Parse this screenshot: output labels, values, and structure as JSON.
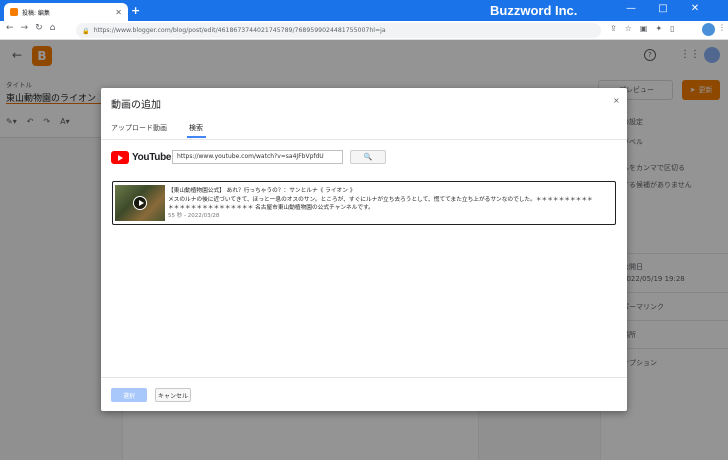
{
  "browser": {
    "tab_title": "投稿: 編集",
    "new_tab": "+",
    "address": "https://www.blogger.com/blog/post/edit/4618673744021745789/7689599024481755007hl=ja",
    "brand": "Buzzword Inc.",
    "window_controls": [
      "—",
      "□",
      "✕"
    ]
  },
  "header": {
    "title_label": "タイトル",
    "title_value": "東山動物園のライオン",
    "preview_label": "プレビュー",
    "update_label": "更新",
    "help_glyph": "?"
  },
  "sidebar": {
    "items": [
      "の設定",
      "ラベル",
      "ルをカンマで区切る",
      "する候補がありません",
      "公開日",
      "2022/05/19 19:28",
      "パーマリンク",
      "場所",
      "オプション"
    ]
  },
  "dialog": {
    "title": "動画の追加",
    "close": "×",
    "tabs": [
      "アップロード動画",
      "検索"
    ],
    "youtube_word": "YouTube",
    "search_value": "https://www.youtube.com/watch?v=sa4JFbVpfdU",
    "search_button": "🔍",
    "result": {
      "title": "【東山動植物園公式】 あれ？行っちゃうの？：サンとルナ《 ライオン 》",
      "desc_line1": "メスのルナの後に近づいてきて、ほっと一息のオスのサン。ところが、すぐにルナが立ち去ろうとして、慌ててまた立ち上がるサンなのでした。＊＊＊＊＊＊＊＊＊＊",
      "desc_line2": "＊＊＊＊＊＊＊＊＊＊＊＊＊＊＊ 名古屋市東山動植物園の公式チャンネルです。",
      "meta": "55 秒 - 2022/03/28"
    },
    "select_label": "選択",
    "cancel_label": "キャンセル"
  }
}
